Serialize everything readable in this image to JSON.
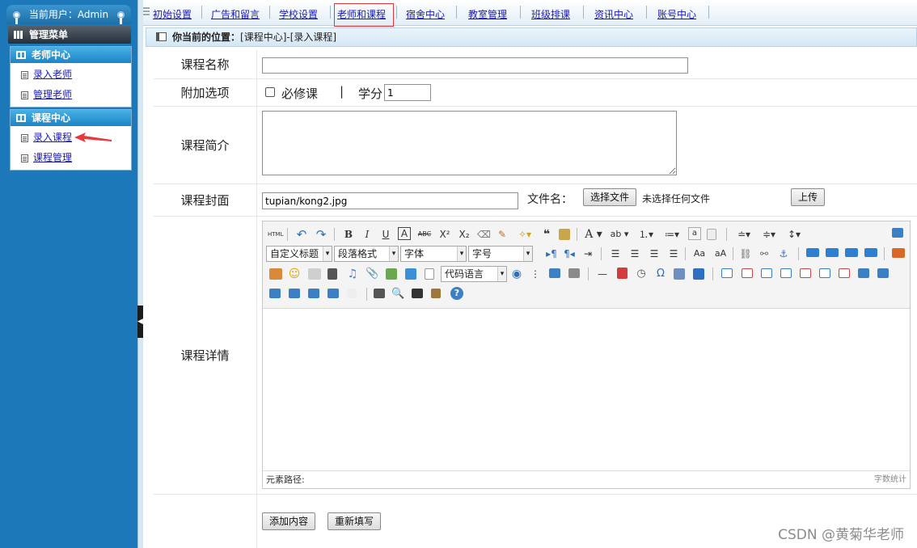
{
  "sidebar": {
    "user_label": "当前用户：Admin",
    "menu_title": "管理菜单",
    "groups": [
      {
        "title": "老师中心",
        "items": [
          {
            "label": "录入老师"
          },
          {
            "label": "管理老师"
          }
        ]
      },
      {
        "title": "课程中心",
        "items": [
          {
            "label": "录入课程"
          },
          {
            "label": "课程管理"
          }
        ]
      }
    ]
  },
  "nav": {
    "items": [
      {
        "label": "初始设置"
      },
      {
        "label": "广告和留言"
      },
      {
        "label": "学校设置"
      },
      {
        "label": "老师和课程"
      },
      {
        "label": "宿舍中心"
      },
      {
        "label": "教室管理"
      },
      {
        "label": "班级排课"
      },
      {
        "label": "资讯中心"
      },
      {
        "label": "账号中心"
      }
    ],
    "active": "老师和课程"
  },
  "breadcrumb": {
    "prefix": "你当前的位置：",
    "path": "[课程中心]-[录入课程]"
  },
  "form": {
    "course_name": {
      "label": "课程名称",
      "value": ""
    },
    "options": {
      "label": "附加选项",
      "required_label": "必修课",
      "required_checked": false,
      "divider": "|",
      "credit_label": "学分",
      "credit_value": "1"
    },
    "intro": {
      "label": "课程简介",
      "value": ""
    },
    "cover": {
      "label": "课程封面",
      "path_value": "tupian/kong2.jpg",
      "filename_label": "文件名：",
      "choose_button": "选择文件",
      "no_file_text": "未选择任何文件",
      "upload_button": "上传"
    },
    "details": {
      "label": "课程详情"
    },
    "submit_button": "添加内容",
    "reset_button": "重新填写"
  },
  "editor": {
    "html_label": "HTML",
    "selects": {
      "heading": "自定义标题",
      "paragraph": "段落格式",
      "font": "字体",
      "size": "字号",
      "code": "代码语言"
    },
    "footer_path_label": "元素路径:",
    "word_count_label": "字数统计"
  },
  "watermark": "CSDN @黄菊华老师",
  "colors": {
    "accent": "#1c78b8",
    "nav_active_border": "#e0373b",
    "link": "#1a1ab5"
  }
}
